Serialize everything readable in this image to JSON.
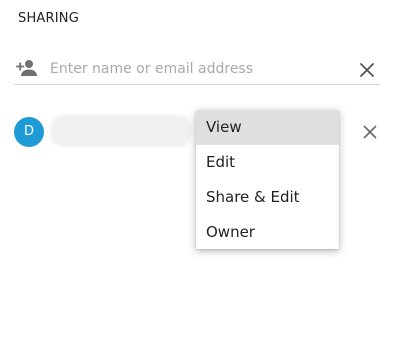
{
  "sharing": {
    "title": "SHARING",
    "invite": {
      "placeholder": "Enter name or email address",
      "value": "",
      "icon": "person-add-icon",
      "clear_icon": "close-icon"
    },
    "member": {
      "avatar_letter": "D",
      "avatar_color": "#1e9ad6",
      "name": "",
      "remove_icon": "close-icon"
    },
    "permission_menu": {
      "selected": "View",
      "options": [
        "View",
        "Edit",
        "Share & Edit",
        "Owner"
      ]
    }
  },
  "colors": {
    "accent": "#1e9ad6",
    "menu_selected_bg": "#dfdfdf",
    "icon_gray": "#707070"
  }
}
